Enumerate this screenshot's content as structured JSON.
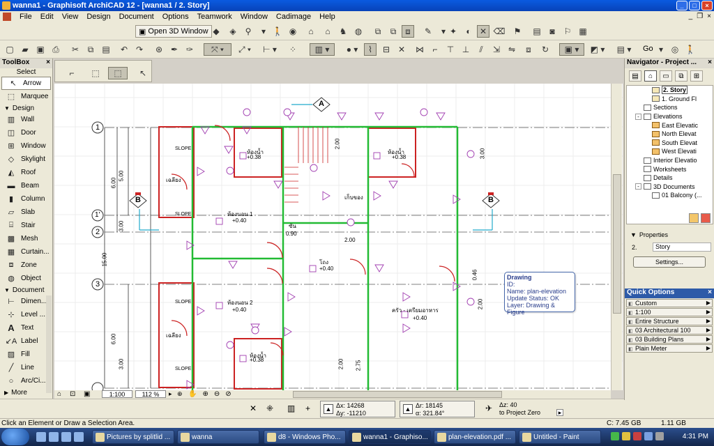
{
  "window": {
    "title": "wanna1 - Graphisoft ArchiCAD 12 - [wanna1 / 2. Story]"
  },
  "menubar": {
    "items": [
      "File",
      "Edit",
      "View",
      "Design",
      "Document",
      "Options",
      "Teamwork",
      "Window",
      "Cadimage",
      "Help"
    ]
  },
  "toolbar": {
    "open_3d_label": "Open 3D Window",
    "go_label": "Go"
  },
  "toolbox": {
    "title": "ToolBox",
    "select_label": "Select",
    "arrow_label": "Arrow",
    "marquee_label": "Marquee",
    "design_label": "Design",
    "document_label": "Document",
    "more_label": "More",
    "design_tools": [
      "Wall",
      "Door",
      "Window",
      "Skylight",
      "Roof",
      "Beam",
      "Column",
      "Slab",
      "Stair",
      "Mesh",
      "Curtain...",
      "Zone",
      "Object"
    ],
    "document_tools": [
      "Dimen...",
      "Level ...",
      "Text",
      "Label",
      "Fill",
      "Line",
      "Arc/Ci..."
    ]
  },
  "navigator": {
    "title": "Navigator - Project ...",
    "tree": [
      {
        "label": "2. Story",
        "indent": 3,
        "kind": "story",
        "selected": true
      },
      {
        "label": "1. Ground Fl",
        "indent": 3,
        "kind": "story",
        "selected": false
      },
      {
        "label": "Sections",
        "indent": 2,
        "kind": "sec",
        "selected": false
      },
      {
        "label": "Elevations",
        "indent": 1,
        "kind": "sec",
        "selected": false,
        "expander": "-"
      },
      {
        "label": "East Elevatic",
        "indent": 3,
        "kind": "elev",
        "selected": false
      },
      {
        "label": "North Elevat",
        "indent": 3,
        "kind": "elev",
        "selected": false
      },
      {
        "label": "South Elevat",
        "indent": 3,
        "kind": "elev",
        "selected": false
      },
      {
        "label": "West Elevati",
        "indent": 3,
        "kind": "elev",
        "selected": false
      },
      {
        "label": "Interior Elevatio",
        "indent": 2,
        "kind": "sec",
        "selected": false
      },
      {
        "label": "Worksheets",
        "indent": 2,
        "kind": "sec",
        "selected": false
      },
      {
        "label": "Details",
        "indent": 2,
        "kind": "sec",
        "selected": false
      },
      {
        "label": "3D Documents",
        "indent": 1,
        "kind": "sec",
        "selected": false,
        "expander": "-"
      },
      {
        "label": "01 Balcony (...",
        "indent": 3,
        "kind": "sec",
        "selected": false
      }
    ],
    "properties_label": "Properties",
    "prop_number": "2.",
    "prop_name": "Story",
    "settings_label": "Settings..."
  },
  "quick_options": {
    "title": "Quick Options",
    "items": [
      "Custom",
      "1:100",
      "Entire Structure",
      "03 Architectural 100",
      "03 Building Plans",
      "Plain Meter"
    ]
  },
  "view_bar": {
    "scale": "1:100",
    "zoom": "112 %"
  },
  "coords": {
    "dx": "Δx: 14268",
    "dy": "Δy: -11210",
    "dr": "Δr: 18145",
    "angle": "α: 321.84°",
    "dz": "Δz: 40",
    "ref": "to Project Zero"
  },
  "status": {
    "message": "Click an Element or Draw a Selection Area.",
    "disk_c": "C: 7.45 GB",
    "disk_mem": "1.11 GB"
  },
  "tooltip": {
    "title": "Drawing",
    "id": "ID:",
    "name": "Name: plan-elevation",
    "update": "Update Status: OK",
    "layer": "Layer: Drawing & Figure"
  },
  "plan": {
    "grid_labels": [
      "1",
      "1'",
      "2",
      "3"
    ],
    "section_markers": [
      "A",
      "B",
      "B"
    ],
    "dims": [
      "5.00",
      "6.00",
      "15.00",
      "6.00",
      "3.00",
      "3.00",
      "2.00",
      "2.00",
      "0.90",
      "2.00",
      "3.00",
      "0.46",
      "2.00",
      "2.75"
    ],
    "rooms": [
      {
        "name": "ห้องนอน 1",
        "level": "+0.40"
      },
      {
        "name": "ห้องนอน 2",
        "level": "+0.40"
      },
      {
        "name": "โถง",
        "level": "+0.40"
      },
      {
        "name": "ครัว - เตรียมอาหาร",
        "level": "+0.40"
      },
      {
        "name": "ห้องน้ำ",
        "level": "+0.38"
      },
      {
        "name": "ห้องน้ำ",
        "level": "+0.38"
      },
      {
        "name": "ห้องน้ำ",
        "level": "+0.38"
      },
      {
        "name": "เก็บของ",
        "level": ""
      },
      {
        "name": "ซัน",
        "level": ""
      },
      {
        "name": "เฉลียง",
        "level": ""
      },
      {
        "name": "เฉลียง",
        "level": ""
      }
    ],
    "slope_label": "SLOPE"
  },
  "taskbar": {
    "tasks": [
      "Pictures by splitlid ...",
      "wanna",
      "d8 - Windows Pho...",
      "wanna1 - Graphiso...",
      "plan-elevation.pdf ...",
      "Untitled - Paint"
    ],
    "clock": "4:31 PM"
  }
}
